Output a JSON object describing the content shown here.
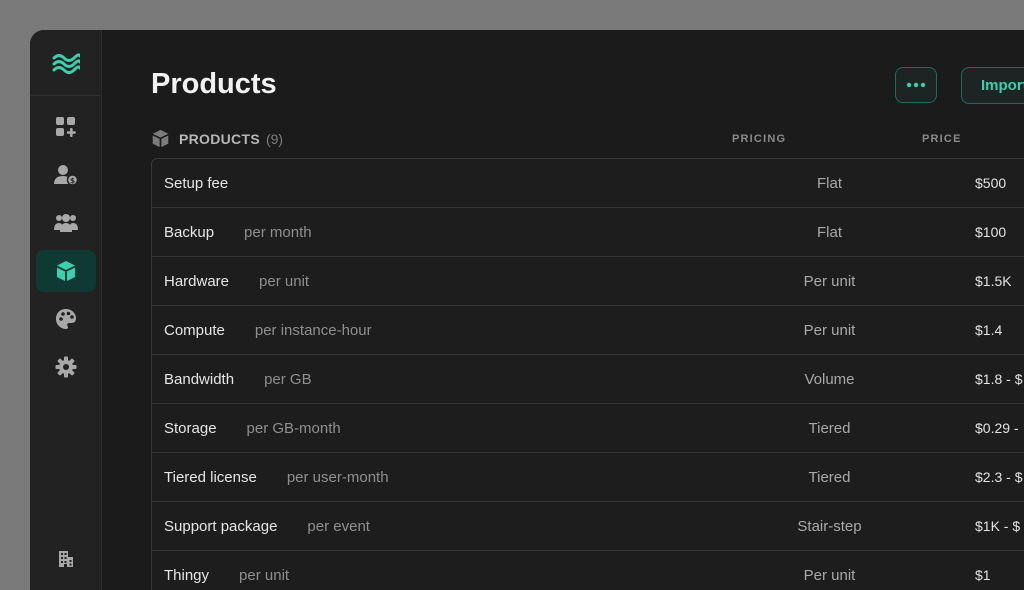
{
  "colors": {
    "accent": "#3ccfae",
    "active_nav_bg": "#0f3a33",
    "icon_gray": "#a8a8a8"
  },
  "sidebar": {
    "logo_icon": "waves-logo-icon",
    "items": [
      {
        "icon": "dashboard-add-icon",
        "active": false
      },
      {
        "icon": "customer-billing-icon",
        "active": false
      },
      {
        "icon": "team-icon",
        "active": false
      },
      {
        "icon": "product-cube-icon",
        "active": true
      },
      {
        "icon": "palette-icon",
        "active": false
      },
      {
        "icon": "gear-icon",
        "active": false
      }
    ],
    "bottom_icon": "building-icon"
  },
  "page": {
    "title": "Products",
    "more_button_icon": "ellipsis-icon",
    "import_label": "Import"
  },
  "section": {
    "icon": "cube-icon",
    "title": "PRODUCTS",
    "count": "(9)"
  },
  "columns": {
    "pricing": "PRICING",
    "price": "PRICE"
  },
  "rows": [
    {
      "name": "Setup fee",
      "unit": "",
      "pricing": "Flat",
      "price": "$500"
    },
    {
      "name": "Backup",
      "unit": "per month",
      "pricing": "Flat",
      "price": "$100"
    },
    {
      "name": "Hardware",
      "unit": "per unit",
      "pricing": "Per unit",
      "price": "$1.5K"
    },
    {
      "name": "Compute",
      "unit": "per instance-hour",
      "pricing": "Per unit",
      "price": "$1.4"
    },
    {
      "name": "Bandwidth",
      "unit": "per GB",
      "pricing": "Volume",
      "price": "$1.8 - $"
    },
    {
      "name": "Storage",
      "unit": "per GB-month",
      "pricing": "Tiered",
      "price": "$0.29 - "
    },
    {
      "name": "Tiered license",
      "unit": "per user-month",
      "pricing": "Tiered",
      "price": "$2.3 - $"
    },
    {
      "name": "Support package",
      "unit": "per event",
      "pricing": "Stair-step",
      "price": "$1K - $"
    },
    {
      "name": "Thingy",
      "unit": "per unit",
      "pricing": "Per unit",
      "price": "$1"
    }
  ]
}
